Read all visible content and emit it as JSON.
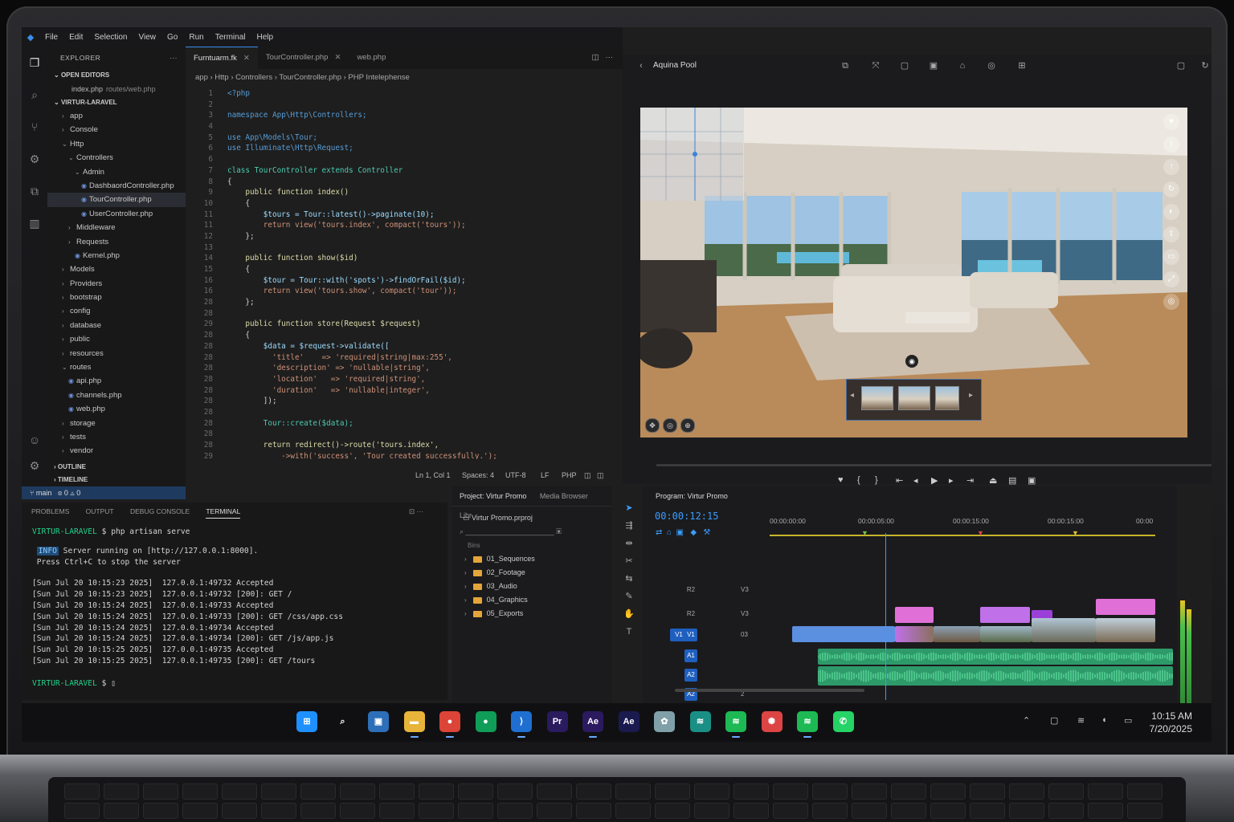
{
  "menu": {
    "items": [
      "File",
      "Edit",
      "Selection",
      "View",
      "Go",
      "Run",
      "Terminal",
      "Help"
    ]
  },
  "explorer": {
    "title": "EXPLORER",
    "open_editors_label": "OPEN EDITORS",
    "open_editor": {
      "name": "index.php",
      "path": "routes/web.php"
    },
    "project_label": "VIRTUR-LARAVEL",
    "tree": [
      {
        "label": "app",
        "indent": 1,
        "type": "folder"
      },
      {
        "label": "Console",
        "indent": 1,
        "type": "folder"
      },
      {
        "label": "Http",
        "indent": 1,
        "type": "folder-open"
      },
      {
        "label": "Controllers",
        "indent": 2,
        "type": "folder-open"
      },
      {
        "label": "Admin",
        "indent": 3,
        "type": "folder-open"
      },
      {
        "label": "DashbaordController.php",
        "indent": 4,
        "type": "file"
      },
      {
        "label": "TourController.php",
        "indent": 4,
        "type": "file",
        "selected": true
      },
      {
        "label": "UserController.php",
        "indent": 4,
        "type": "file"
      },
      {
        "label": "Middleware",
        "indent": 2,
        "type": "folder"
      },
      {
        "label": "Requests",
        "indent": 2,
        "type": "folder"
      },
      {
        "label": "Kernel.php",
        "indent": 3,
        "type": "file"
      },
      {
        "label": "Models",
        "indent": 1,
        "type": "folder"
      },
      {
        "label": "Providers",
        "indent": 1,
        "type": "folder"
      },
      {
        "label": "bootstrap",
        "indent": 1,
        "type": "folder"
      },
      {
        "label": "config",
        "indent": 1,
        "type": "folder"
      },
      {
        "label": "database",
        "indent": 1,
        "type": "folder"
      },
      {
        "label": "public",
        "indent": 1,
        "type": "folder"
      },
      {
        "label": "resources",
        "indent": 1,
        "type": "folder"
      },
      {
        "label": "routes",
        "indent": 1,
        "type": "folder-open"
      },
      {
        "label": "api.php",
        "indent": 2,
        "type": "file"
      },
      {
        "label": "channels.php",
        "indent": 2,
        "type": "file"
      },
      {
        "label": "web.php",
        "indent": 2,
        "type": "file"
      },
      {
        "label": "storage",
        "indent": 1,
        "type": "folder"
      },
      {
        "label": "tests",
        "indent": 1,
        "type": "folder"
      },
      {
        "label": "vendor",
        "indent": 1,
        "type": "folder"
      }
    ],
    "outline_label": "OUTLINE",
    "timeline_label": "TIMELINE",
    "git_branch": "main"
  },
  "editor": {
    "tabs": [
      {
        "label": "Furntuarm.fk",
        "active": true
      },
      {
        "label": "TourController.php"
      },
      {
        "label": "web.php"
      }
    ],
    "breadcrumb": "app  ›  Http  ›  Controllers  ›  TourController.php  ›  PHP Intelephense",
    "lines": [
      {
        "n": "1",
        "t": "<?php",
        "c": "kw"
      },
      {
        "n": "2",
        "t": "",
        "c": "pl"
      },
      {
        "n": "3",
        "t": "namespace App\\Http\\Controllers;",
        "c": "kw"
      },
      {
        "n": "4",
        "t": "",
        "c": "pl"
      },
      {
        "n": "5",
        "t": "use App\\Models\\Tour;",
        "c": "kw"
      },
      {
        "n": "6",
        "t": "use Illuminate\\Http\\Request;",
        "c": "kw"
      },
      {
        "n": "6",
        "t": "",
        "c": "pl"
      },
      {
        "n": "7",
        "t": "class TourController extends Controller",
        "c": "cls"
      },
      {
        "n": "8",
        "t": "{",
        "c": "pl"
      },
      {
        "n": "9",
        "t": "    public function index()",
        "c": "fn"
      },
      {
        "n": "10",
        "t": "    {",
        "c": "pl"
      },
      {
        "n": "11",
        "t": "        $tours = Tour::latest()->paginate(10);",
        "c": "vr"
      },
      {
        "n": "11",
        "t": "        return view('tours.index', compact('tours'));",
        "c": "st"
      },
      {
        "n": "12",
        "t": "    };",
        "c": "pl"
      },
      {
        "n": "13",
        "t": "",
        "c": "pl"
      },
      {
        "n": "14",
        "t": "    public function show($id)",
        "c": "fn"
      },
      {
        "n": "15",
        "t": "    {",
        "c": "pl"
      },
      {
        "n": "16",
        "t": "        $tour = Tour::with('spots')->findOrFail($id);",
        "c": "vr"
      },
      {
        "n": "16",
        "t": "        return view('tours.show', compact('tour'));",
        "c": "st"
      },
      {
        "n": "28",
        "t": "    };",
        "c": "pl"
      },
      {
        "n": "28",
        "t": "",
        "c": "pl"
      },
      {
        "n": "29",
        "t": "    public function store(Request $request)",
        "c": "fn"
      },
      {
        "n": "28",
        "t": "    {",
        "c": "pl"
      },
      {
        "n": "28",
        "t": "        $data = $request->validate([",
        "c": "vr"
      },
      {
        "n": "28",
        "t": "          'title'    => 'required|string|max:255',",
        "c": "st"
      },
      {
        "n": "28",
        "t": "          'description' => 'nullable|string',",
        "c": "st"
      },
      {
        "n": "28",
        "t": "          'location'   => 'required|string',",
        "c": "st"
      },
      {
        "n": "28",
        "t": "          'duration'   => 'nullable|integer',",
        "c": "st"
      },
      {
        "n": "28",
        "t": "        ]);",
        "c": "pl"
      },
      {
        "n": "28",
        "t": "",
        "c": "pl"
      },
      {
        "n": "28",
        "t": "        Tour::create($data);",
        "c": "cls"
      },
      {
        "n": "28",
        "t": "",
        "c": "pl"
      },
      {
        "n": "28",
        "t": "        return redirect()->route('tours.index',",
        "c": "fn"
      },
      {
        "n": "29",
        "t": "            ->with('success', 'Tour created successfully.');",
        "c": "st"
      },
      {
        "n": "28",
        "t": "    }",
        "c": "pl"
      }
    ],
    "status": {
      "pos": "Ln 1, Col 1",
      "spaces": "Spaces: 4",
      "enc": "UTF-8",
      "eol": "LF",
      "lang": "PHP"
    }
  },
  "terminal": {
    "tabs": [
      "PROBLEMS",
      "OUTPUT",
      "DEBUG CONSOLE",
      "TERMINAL"
    ],
    "active_tab": "TERMINAL",
    "prompt": "VIRTUR-LARAVEL",
    "command": "$ php artisan serve",
    "info_tag": "INFO",
    "info_text": " Server running on [http://127.0.0.1:8000].",
    "stop_text": "Press Ctrl+C to stop the server",
    "logs": [
      "[Sun Jul 20 10:15:23 2025]  127.0.0.1:49732 Accepted",
      "[Sun Jul 20 10:15:23 2025]  127.0.0.1:49732 [200]: GET /",
      "[Sun Jul 20 10:15:24 2025]  127.0.0.1:49733 Accepted",
      "[Sun Jul 20 10:15:24 2025]  127.0.0.1:49733 [200]: GET /css/app.css",
      "[Sun Jul 20 10:15:24 2025]  127.0.0.1:49734 Accepted",
      "[Sun Jul 20 10:15:24 2025]  127.0.0.1:49734 [200]: GET /js/app.js",
      "[Sun Jul 20 10:15:25 2025]  127.0.0.1:49735 Accepted",
      "[Sun Jul 20 10:15:25 2025]  127.0.0.1:49735 [200]: GET /tours"
    ],
    "end_prompt": "VIRTUR-LARAVEL",
    "end_cmd": "$"
  },
  "viewer": {
    "title": "Aquina Pool"
  },
  "project": {
    "tabs": [
      "Project: Virtur Promo",
      "Media Browser",
      "Libr"
    ],
    "file": "Virtur Promo.prproj",
    "bins_label": "Bins",
    "folders": [
      "01_Sequences",
      "02_Footage",
      "03_Audio",
      "04_Graphics",
      "05_Exports"
    ]
  },
  "timeline": {
    "title": "Program: Virtur Promo",
    "timecode": "00:00:12:15",
    "ruler": [
      "00:00:00:00",
      "00:00:05:00",
      "00:00:15:00",
      "00:00:15:00",
      "00:00"
    ],
    "tracks": [
      {
        "tag": "R2",
        "name": "V3"
      },
      {
        "tag": "R2",
        "name": "V3"
      },
      {
        "tag": "V1",
        "name": "03"
      },
      {
        "tag": "A1",
        "name": ""
      },
      {
        "tag": "A2",
        "name": ""
      },
      {
        "tag": "A2",
        "name": "2"
      }
    ]
  },
  "taskbar": {
    "apps": [
      {
        "name": "windows-start",
        "glyph": "⊞",
        "bg": "#1e90ff"
      },
      {
        "name": "search",
        "glyph": "⌕",
        "bg": "transparent"
      },
      {
        "name": "task-view",
        "glyph": "▣",
        "bg": "#2d6fb8"
      },
      {
        "name": "file-explorer",
        "glyph": "▬",
        "bg": "#e8b53a"
      },
      {
        "name": "chrome",
        "glyph": "●",
        "bg": "#db4437"
      },
      {
        "name": "chrome-2",
        "glyph": "●",
        "bg": "#0f9d58"
      },
      {
        "name": "vscode",
        "glyph": "⟩",
        "bg": "#1f6fd1"
      },
      {
        "name": "premiere",
        "glyph": "Pr",
        "bg": "#2a1a5e"
      },
      {
        "name": "after-effects",
        "glyph": "Ae",
        "bg": "#2b1a5f"
      },
      {
        "name": "after-effects-2",
        "glyph": "Ae",
        "bg": "#1b1a4f"
      },
      {
        "name": "photos",
        "glyph": "✿",
        "bg": "#7fa0a8"
      },
      {
        "name": "spotify-like",
        "glyph": "≋",
        "bg": "#1a8f86"
      },
      {
        "name": "spotify",
        "glyph": "≋",
        "bg": "#1db954"
      },
      {
        "name": "pinwheel",
        "glyph": "✺",
        "bg": "#d44"
      },
      {
        "name": "spotify-2",
        "glyph": "≋",
        "bg": "#1db954"
      },
      {
        "name": "whatsapp",
        "glyph": "✆",
        "bg": "#25d366"
      }
    ],
    "time": "10:15 AM",
    "date": "7/20/2025"
  }
}
